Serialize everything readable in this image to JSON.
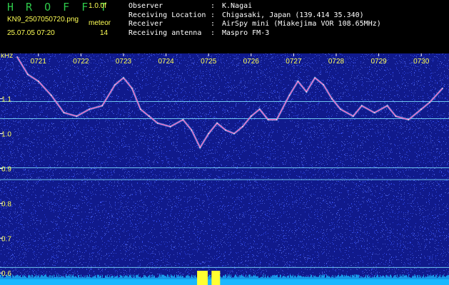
{
  "header": {
    "title": "H R O F F T",
    "version": "1.0.0f",
    "filename": "KN9_2507050720.png",
    "datetime": "25.07.05 07:20",
    "meteor_label": "meteor",
    "meteor_count": "14"
  },
  "info": [
    {
      "key": "Observer",
      "value": "K.Nagai"
    },
    {
      "key": "Receiving Location",
      "value": "Chigasaki, Japan (139.414 35.340)"
    },
    {
      "key": "Receiver",
      "value": "AirSpy mini (Miakejima VOR 108.65MHz)"
    },
    {
      "key": "Receiving antenna",
      "value": "Maspro FM-3"
    }
  ],
  "colors": {
    "background": "#101a8c",
    "noise_a": "#3a55ff",
    "noise_b": "#0c1f9a",
    "trace": "#ff6acb",
    "trace_halo": "#55e0ff",
    "line": "#7fe3ff",
    "bottom": "#19b8ff",
    "burst": "#ffff30",
    "label": "#ffff55"
  },
  "chart_data": {
    "type": "heatmap",
    "unit_label": "kHz",
    "x_ticks": [
      "0721",
      "0722",
      "0723",
      "0724",
      "0725",
      "0726",
      "0727",
      "0728",
      "0729",
      "0730"
    ],
    "y_ticks": [
      "1.1",
      "1.0",
      "0.9",
      "0.8",
      "0.7",
      "0.6"
    ],
    "y_tick_values": [
      1.1,
      1.0,
      0.9,
      0.8,
      0.7,
      0.6
    ],
    "ylim": [
      0.58,
      1.23
    ],
    "xlim": [
      0,
      10
    ],
    "horizontal_lines_khz": [
      1.092,
      1.043,
      0.902,
      0.868,
      0.616
    ],
    "doppler_trace": [
      {
        "x": 0.0,
        "y": 1.22
      },
      {
        "x": 0.25,
        "y": 1.17
      },
      {
        "x": 0.5,
        "y": 1.15
      },
      {
        "x": 0.8,
        "y": 1.11
      },
      {
        "x": 1.1,
        "y": 1.06
      },
      {
        "x": 1.4,
        "y": 1.05
      },
      {
        "x": 1.7,
        "y": 1.07
      },
      {
        "x": 2.0,
        "y": 1.08
      },
      {
        "x": 2.3,
        "y": 1.14
      },
      {
        "x": 2.5,
        "y": 1.16
      },
      {
        "x": 2.7,
        "y": 1.13
      },
      {
        "x": 2.9,
        "y": 1.07
      },
      {
        "x": 3.1,
        "y": 1.05
      },
      {
        "x": 3.3,
        "y": 1.03
      },
      {
        "x": 3.6,
        "y": 1.02
      },
      {
        "x": 3.9,
        "y": 1.04
      },
      {
        "x": 4.1,
        "y": 1.01
      },
      {
        "x": 4.3,
        "y": 0.96
      },
      {
        "x": 4.5,
        "y": 1.0
      },
      {
        "x": 4.7,
        "y": 1.03
      },
      {
        "x": 4.9,
        "y": 1.01
      },
      {
        "x": 5.1,
        "y": 1.0
      },
      {
        "x": 5.3,
        "y": 1.02
      },
      {
        "x": 5.5,
        "y": 1.05
      },
      {
        "x": 5.7,
        "y": 1.07
      },
      {
        "x": 5.9,
        "y": 1.04
      },
      {
        "x": 6.1,
        "y": 1.04
      },
      {
        "x": 6.4,
        "y": 1.11
      },
      {
        "x": 6.6,
        "y": 1.15
      },
      {
        "x": 6.8,
        "y": 1.12
      },
      {
        "x": 7.0,
        "y": 1.16
      },
      {
        "x": 7.2,
        "y": 1.14
      },
      {
        "x": 7.4,
        "y": 1.1
      },
      {
        "x": 7.6,
        "y": 1.07
      },
      {
        "x": 7.9,
        "y": 1.05
      },
      {
        "x": 8.1,
        "y": 1.08
      },
      {
        "x": 8.4,
        "y": 1.06
      },
      {
        "x": 8.7,
        "y": 1.08
      },
      {
        "x": 8.9,
        "y": 1.05
      },
      {
        "x": 9.2,
        "y": 1.04
      },
      {
        "x": 9.5,
        "y": 1.07
      },
      {
        "x": 9.7,
        "y": 1.09
      },
      {
        "x": 10.0,
        "y": 1.13
      }
    ],
    "meteor_bursts_x": [
      4.28,
      4.33,
      4.38,
      4.43,
      4.62,
      4.67,
      4.72
    ]
  }
}
